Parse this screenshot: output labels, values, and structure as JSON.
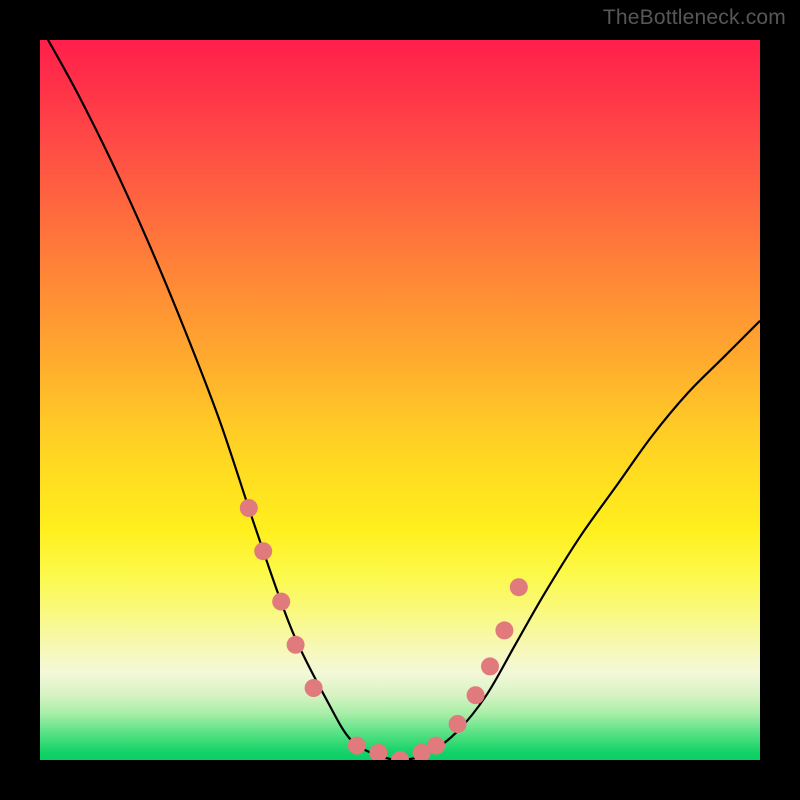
{
  "watermark": "TheBottleneck.com",
  "chart_data": {
    "type": "line",
    "title": "",
    "xlabel": "",
    "ylabel": "",
    "xlim": [
      0,
      100
    ],
    "ylim": [
      0,
      100
    ],
    "grid": false,
    "legend": false,
    "series": [
      {
        "name": "bottleneck-curve",
        "x": [
          0,
          5,
          10,
          15,
          20,
          25,
          30,
          35,
          40,
          43,
          46,
          50,
          54,
          58,
          62,
          66,
          70,
          75,
          80,
          85,
          90,
          95,
          100
        ],
        "values": [
          102,
          93,
          83,
          72,
          60,
          47,
          32,
          18,
          8,
          3,
          1,
          0,
          1,
          4,
          9,
          16,
          23,
          31,
          38,
          45,
          51,
          56,
          61
        ]
      }
    ],
    "markers": {
      "name": "highlight-points",
      "x": [
        29,
        31,
        33.5,
        35.5,
        38,
        44,
        47,
        50,
        53,
        55,
        58,
        60.5,
        62.5,
        64.5,
        66.5
      ],
      "values": [
        35,
        29,
        22,
        16,
        10,
        2,
        1,
        0,
        1,
        2,
        5,
        9,
        13,
        18,
        24
      ]
    },
    "background_gradient": {
      "top": "#ff1f4b",
      "mid": "#ffef1e",
      "bottom": "#0bcf64"
    }
  }
}
